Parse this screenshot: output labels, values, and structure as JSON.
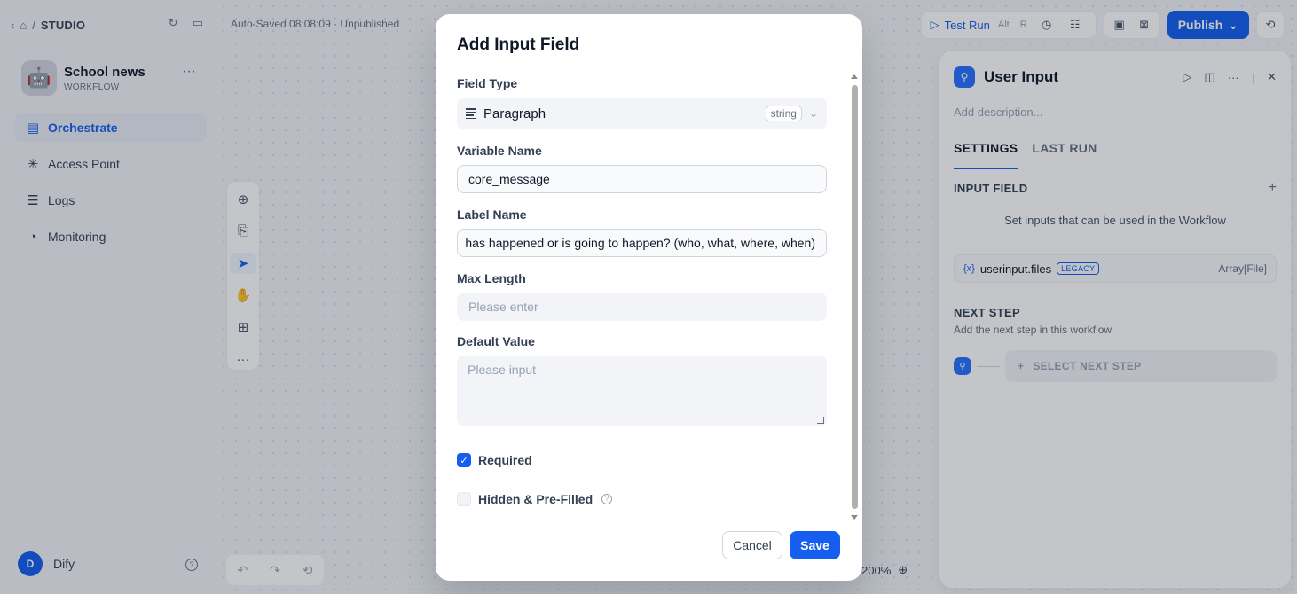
{
  "nav": {
    "studio": "STUDIO",
    "app_name": "School news",
    "app_type": "WORKFLOW",
    "app_emoji": "🤖",
    "items": [
      {
        "label": "Orchestrate",
        "icon": "orchestrate-icon"
      },
      {
        "label": "Access Point",
        "icon": "access-point-icon"
      },
      {
        "label": "Logs",
        "icon": "logs-icon"
      },
      {
        "label": "Monitoring",
        "icon": "monitoring-icon"
      }
    ],
    "user_initial": "D",
    "user_name": "Dify"
  },
  "canvas": {
    "autosave": "Auto-Saved 08:08:09 · Unpublished",
    "zoom": "200%"
  },
  "topbar": {
    "test_run": "Test Run",
    "shortcut_alt": "Alt",
    "shortcut_key": "R",
    "publish": "Publish"
  },
  "panel": {
    "title": "User Input",
    "description_placeholder": "Add description...",
    "tabs": [
      "SETTINGS",
      "LAST RUN"
    ],
    "input_field_label": "INPUT FIELD",
    "hint": "Set inputs that can be used in the Workflow",
    "variable": {
      "icon": "{x}",
      "name": "userinput.files",
      "badge": "LEGACY",
      "type": "Array[File]"
    },
    "next_step_label": "NEXT STEP",
    "next_step_sub": "Add the next step in this workflow",
    "select_next": "SELECT NEXT STEP"
  },
  "modal": {
    "title": "Add Input Field",
    "field_type_label": "Field Type",
    "field_type_value": "Paragraph",
    "field_type_tag": "string",
    "variable_name_label": "Variable Name",
    "variable_name_value": "core_message",
    "label_name_label": "Label Name",
    "label_name_value": "has happened or is going to happen? (who, what, where, when)",
    "max_length_label": "Max Length",
    "max_length_placeholder": "Please enter",
    "default_value_label": "Default Value",
    "default_value_placeholder": "Please input",
    "required_label": "Required",
    "required_checked": true,
    "hidden_label": "Hidden & Pre-Filled",
    "hidden_checked": false,
    "cancel": "Cancel",
    "save": "Save"
  },
  "colors": {
    "accent": "#155eef",
    "overlay": "rgba(16,24,40,0.25)"
  }
}
